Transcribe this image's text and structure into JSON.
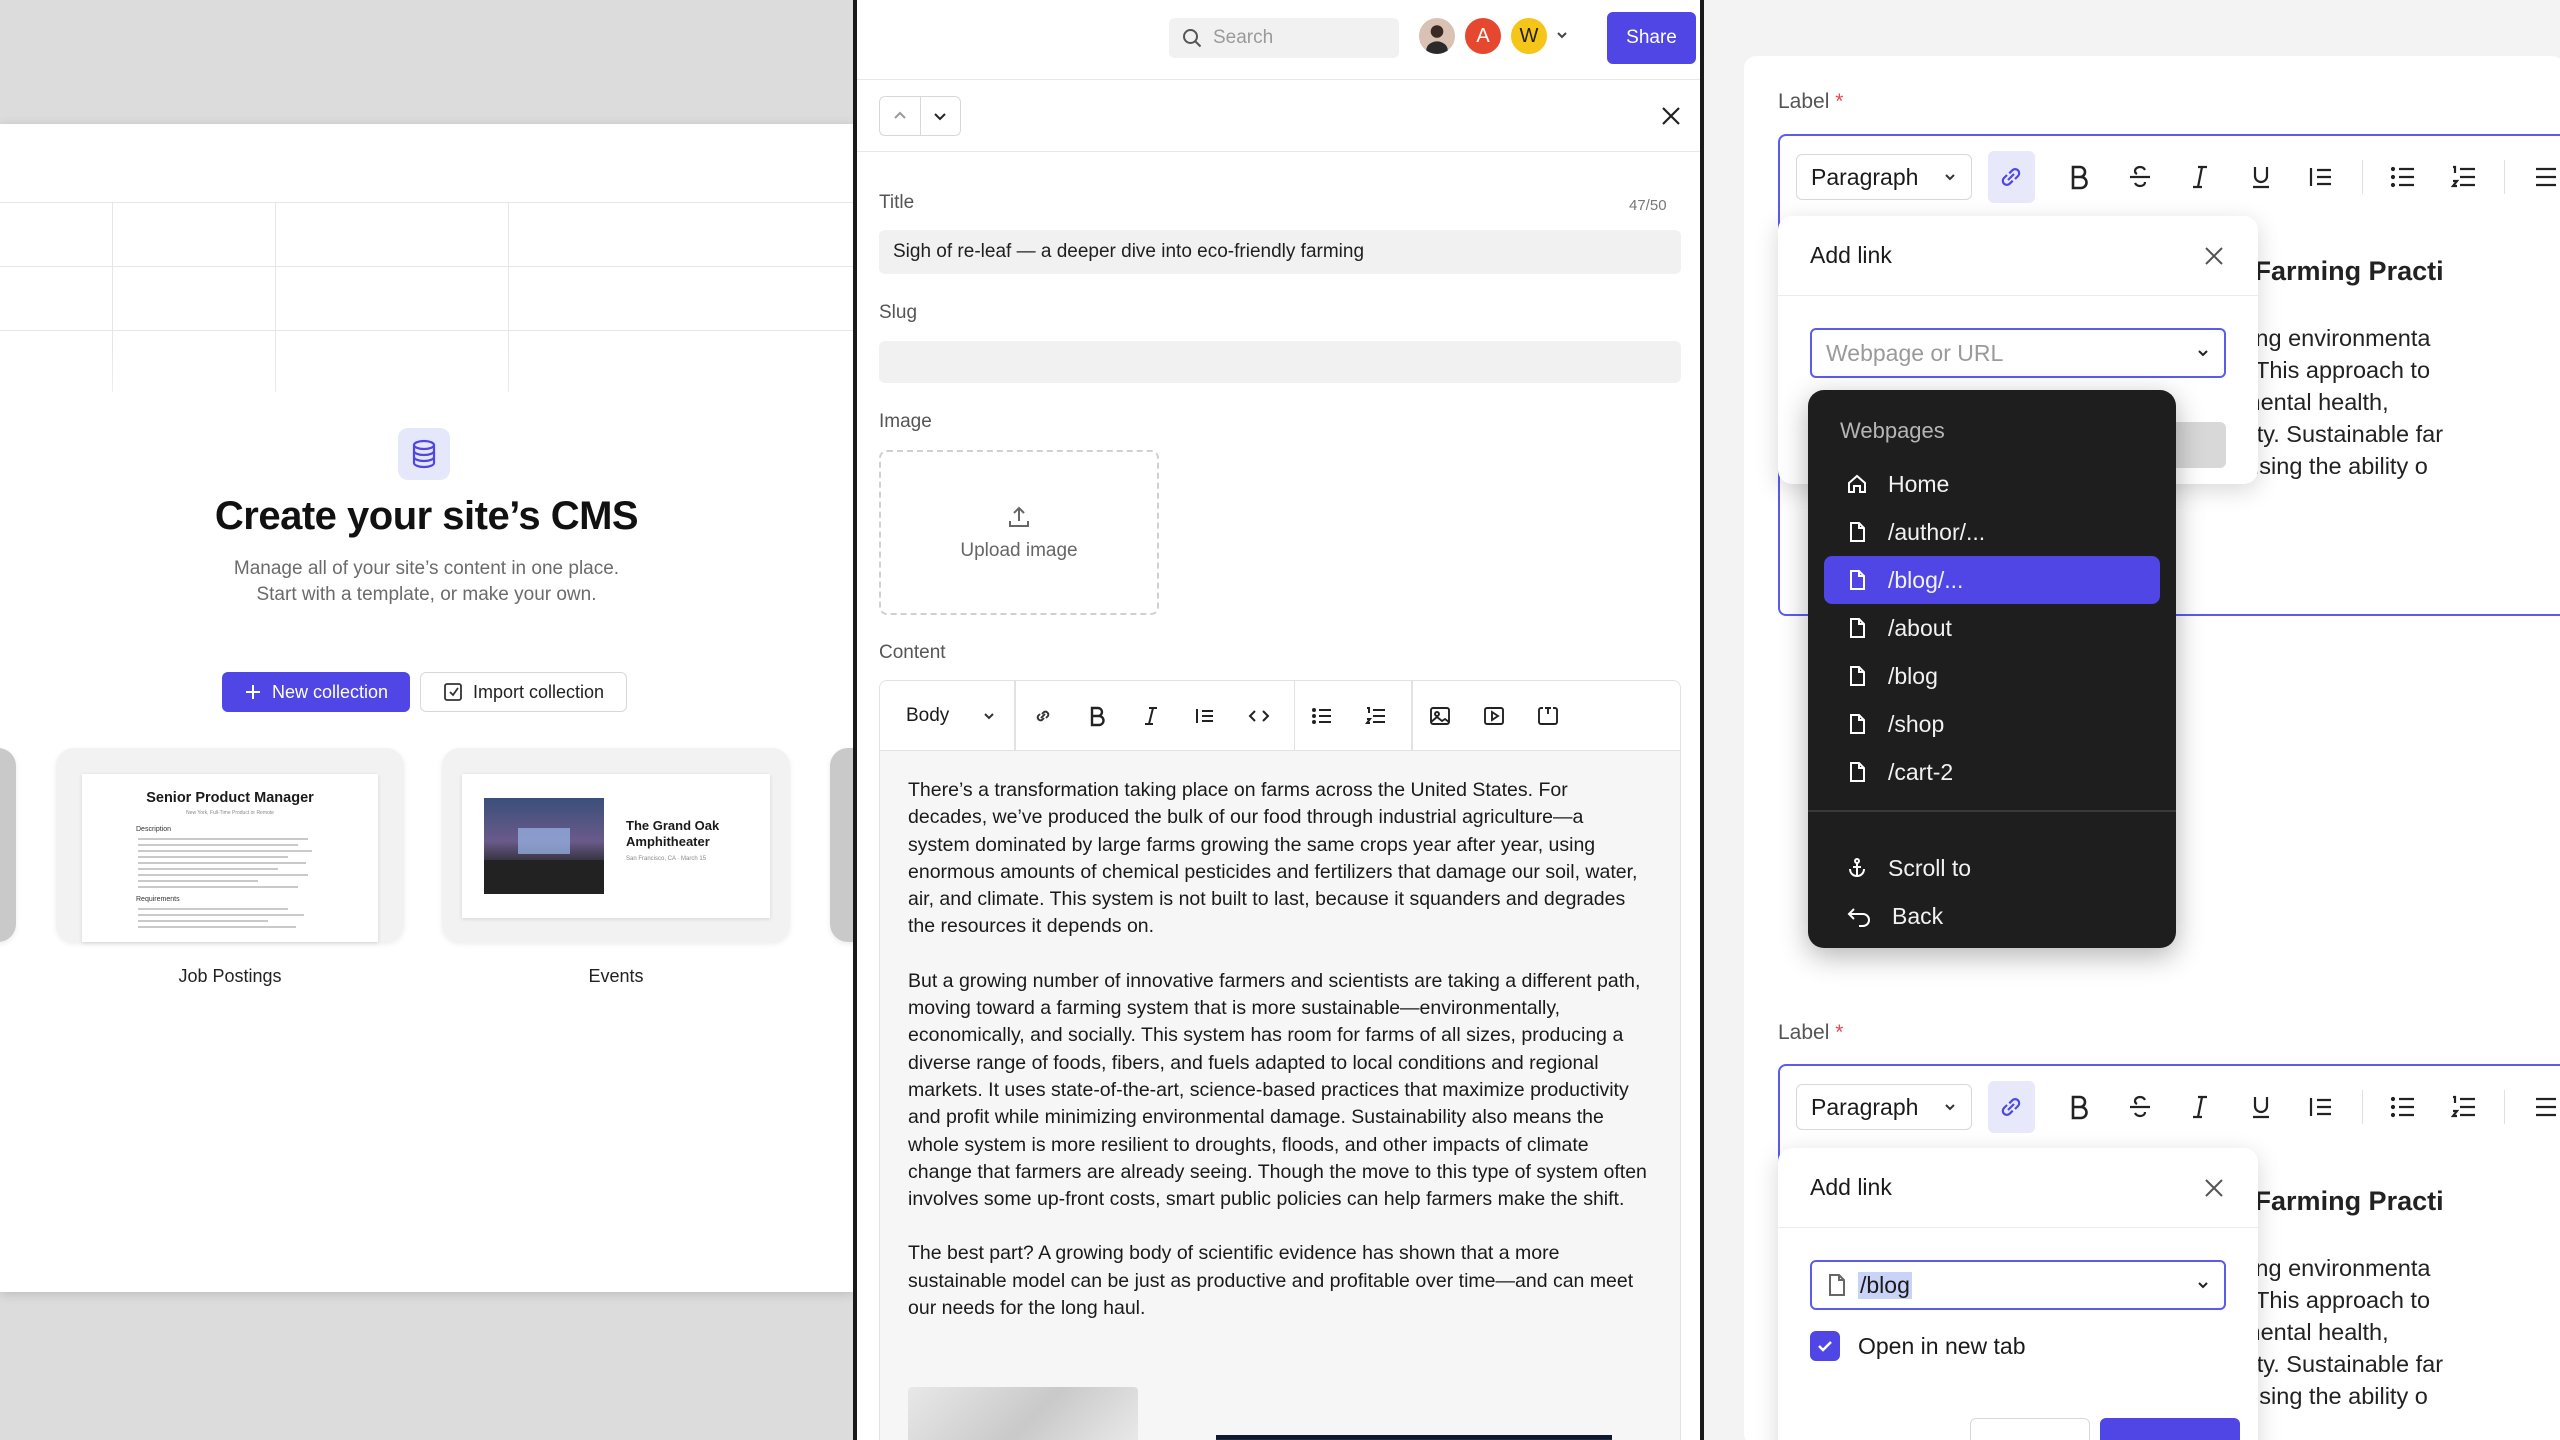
{
  "left": {
    "cms_title": "Create your site’s CMS",
    "cms_sub_1": "Manage all of your site’s content in one place.",
    "cms_sub_2": "Start with a template, or make your own.",
    "new_collection": "New collection",
    "import_collection": "Import collection",
    "templates": [
      {
        "label": "Job Postings",
        "doc_title": "Senior Product Manager",
        "doc_sub": "New York, Full-Time Product or Remote",
        "section_1": "Description",
        "section_2": "Requirements"
      },
      {
        "label": "Events",
        "doc_title": "The Grand Oak Amphitheater",
        "doc_sub": "San Francisco, CA · March 15"
      }
    ]
  },
  "middle": {
    "search_placeholder": "Search",
    "avatars": [
      "A",
      "W"
    ],
    "share": "Share",
    "title_label": "Title",
    "title_counter": "47/50",
    "title_value": "Sigh of re-leaf — a deeper dive into eco-friendly farming",
    "slug_label": "Slug",
    "slug_value": "",
    "image_label": "Image",
    "upload_text": "Upload image",
    "content_label": "Content",
    "block_type": "Body",
    "paragraphs": [
      "There’s a transformation taking place on farms across the United States. For decades, we’ve produced the bulk of our food through industrial agriculture—a system dominated by large farms growing the same crops year after year, using enormous amounts of chemical pesticides and fertilizers that damage our soil, water, air, and climate. This system is not built to last, because it squanders and degrades the resources it depends on.",
      "But a growing number of innovative farmers and scientists are taking a different path, moving toward a farming system that is more sustainable—environmentally, economically, and socially. This system has room for farms of all sizes, producing a diverse range of foods, fibers, and fuels adapted to local conditions and regional markets. It uses state-of-the-art, science-based practices that maximize productivity and profit while minimizing environmental damage. Sustainability also means the whole system is more resilient to droughts, floods, and other impacts of climate change that farmers are already seeing. Though the move to this type of system often involves some up-front costs, smart public policies can help farmers make the shift.",
      "The best part? A growing body of scientific evidence has shown that a more sustainable model can be just as productive and profitable over time—and can meet our needs for the long haul."
    ]
  },
  "right": {
    "label": "Label",
    "required_mark": "*",
    "paragraph_style": "Paragraph",
    "behind_title": "stainable Farming Practi",
    "behind_lines": [
      "and escalating environmenta",
      "e essential. This approach to",
      "ort environmental health,",
      "onomic equity. Sustainable far",
      "ut compromising the ability o"
    ],
    "popover_title": "Add link",
    "url_placeholder": "Webpage or URL",
    "dropdown_heading": "Webpages",
    "dropdown_items": [
      "Home",
      "/author/...",
      "/blog/...",
      "/about",
      "/blog",
      "/shop",
      "/cart-2"
    ],
    "dropdown_actions": [
      "Scroll to",
      "Back"
    ],
    "selected_url": "/blog",
    "open_new_tab": "Open in new tab",
    "accent": "#4f46e5"
  }
}
